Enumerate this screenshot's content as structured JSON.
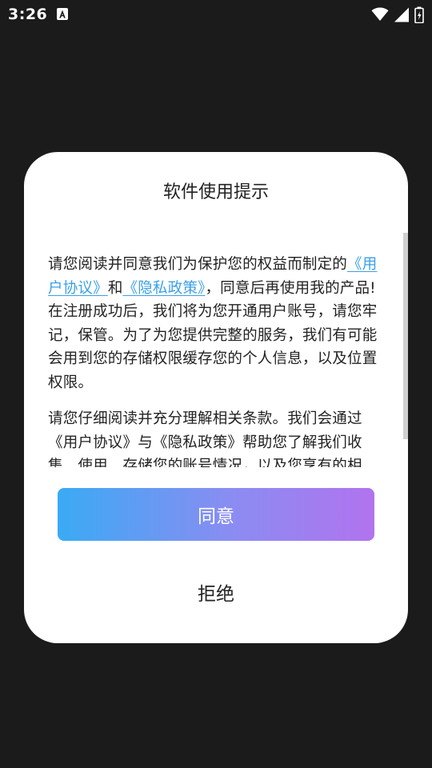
{
  "status_bar": {
    "time": "3:26",
    "icons": [
      "accessibility-a-icon",
      "wifi-icon",
      "signal-icon",
      "battery-icon"
    ]
  },
  "dialog": {
    "title": "软件使用提示",
    "paragraph1": {
      "intro": "请您阅读并同意我们为保护您的权益而制定的",
      "link_user_agreement": "《用户协议》",
      "and": "和",
      "link_privacy_policy": "《隐私政策》",
      "rest": "，同意后再使用我的产品!在注册成功后，我们将为您开通用户账号，请您牢记，保管。为了为您提供完整的服务，我们有可能会用到您的存储权限缓存您的个人信息，以及位置权限。"
    },
    "paragraph2": "请您仔细阅读并充分理解相关条款。我们会通过《用户协议》与《隐私政策》帮助您了解我们收集、使用、存储您的账号情况，以及您享有的相",
    "agree_label": "同意",
    "reject_label": "拒绝"
  },
  "colors": {
    "background": "#1b1b1b",
    "dialog": "#ffffff",
    "link": "#3aa0e8",
    "button_gradient_start": "#3aaaf4",
    "button_gradient_end": "#b173ef"
  }
}
